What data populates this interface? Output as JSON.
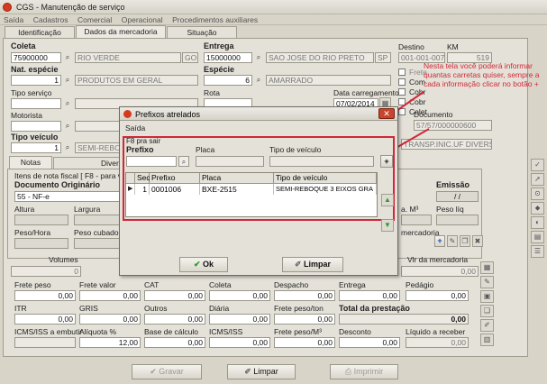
{
  "window": {
    "title": "CGS - Manutenção de serviço"
  },
  "menu": [
    "Saída",
    "Cadastros",
    "Comercial",
    "Operacional",
    "Procedimentos auxiliares"
  ],
  "tabs": [
    "Identificação",
    "Dados da mercadoria",
    "Situação"
  ],
  "coleta": {
    "label": "Coleta",
    "code": "75900000",
    "city": "RIO VERDE",
    "uf": "GO"
  },
  "entrega": {
    "label": "Entrega",
    "code": "15000000",
    "city": "SAO JOSE DO RIO PRETO",
    "uf": "SP"
  },
  "destino": {
    "label": "Destino",
    "value": "001-001-007"
  },
  "km": {
    "label": "KM",
    "value": "519"
  },
  "nat_especie": {
    "label": "Nat. espécie",
    "code": "1",
    "desc": "PRODUTOS EM GERAL"
  },
  "especie": {
    "label": "Espécie",
    "code": "6",
    "desc": "AMARRADO"
  },
  "tipo_servico": {
    "label": "Tipo serviço"
  },
  "rota": {
    "label": "Rota"
  },
  "data_carregamento": {
    "label": "Data carregamento",
    "value": "07/02/2014"
  },
  "motorista": {
    "label": "Motorista"
  },
  "tipo_veiculo": {
    "label": "Tipo veículo",
    "code": "1",
    "desc": "SEMI-REBOQUE"
  },
  "right_checks": [
    "Frete",
    "Com",
    "Cobr",
    "Cobr",
    "Colet"
  ],
  "documento": {
    "label": "Documento",
    "value": "57/57/000000600"
  },
  "transp": "TRANSP.INIC.UF DIVERSA",
  "lower_tabs": [
    "Notas fiscais",
    "Diver"
  ],
  "itens_note": "Itens de nota fiscal [ F8 - para visu",
  "doc_originario": {
    "label": "Documento Originário",
    "value": "55 - NF-e"
  },
  "emissao": {
    "label": "Emissão",
    "value": "/ /"
  },
  "altura": "Altura",
  "largura": "Largura",
  "peso_hora": "Peso/Hora",
  "peso_cubado": "Peso cubado",
  "am3": "a. M³",
  "peso_liq": "Peso líq",
  "mercadoria": "mercadoria",
  "volumes": {
    "label": "Volumes",
    "value": "0"
  },
  "vlr_mercadoria": {
    "label": "Vlr da mercadoria",
    "value": "0,00"
  },
  "row1": [
    {
      "label": "Frete peso",
      "value": "0,00"
    },
    {
      "label": "Frete valor",
      "value": "0,00"
    },
    {
      "label": "CAT",
      "value": "0,00"
    },
    {
      "label": "Coleta",
      "value": "0,00"
    },
    {
      "label": "Despacho",
      "value": "0,00"
    },
    {
      "label": "Entrega",
      "value": "0,00"
    },
    {
      "label": "Pedágio",
      "value": "0,00"
    }
  ],
  "row2": [
    {
      "label": "ITR",
      "value": "0,00"
    },
    {
      "label": "GRIS",
      "value": "0,00"
    },
    {
      "label": "Outros",
      "value": "0,00"
    },
    {
      "label": "Diária",
      "value": "0,00"
    },
    {
      "label": "Frete peso/ton",
      "value": "0,00"
    },
    {
      "label": "Total da prestação",
      "value": "0,00"
    }
  ],
  "row3": [
    {
      "label": "ICMS/ISS a embutir",
      "value": ""
    },
    {
      "label": "Alíquota %",
      "value": "12,00"
    },
    {
      "label": "Base de cálculo",
      "value": "0,00"
    },
    {
      "label": "ICMS/ISS",
      "value": "0,00"
    },
    {
      "label": "Frete peso/M³",
      "value": "0,00"
    },
    {
      "label": "Desconto",
      "value": "0,00"
    },
    {
      "label": "Líquido a receber",
      "value": "0,00"
    }
  ],
  "bottom_buttons": {
    "gravar": "Gravar",
    "limpar": "Limpar",
    "imprimir": "Imprimir"
  },
  "dialog": {
    "title": "Prefixos atrelados",
    "menu": "Saída",
    "hint": "F8 pra sair",
    "prefixo_label": "Prefixo",
    "placa_label": "Placa",
    "tipo_label": "Tipo de veículo",
    "columns": [
      "Seq",
      "Prefixo",
      "Placa",
      "Tipo de veículo"
    ],
    "rows": [
      [
        "1",
        "0001006",
        "BXE-2515",
        "SEMI-REBOQUE 3 EIXOS GRA"
      ]
    ],
    "ok": "Ok",
    "limpar": "Limpar"
  },
  "annotation": "Nesta tela você poderá informar quantas carretas quiser, sempre a cada informação clicar no botão +",
  "colors": {
    "accent_red": "#d0283a",
    "title_icon": "#d63a1e"
  }
}
